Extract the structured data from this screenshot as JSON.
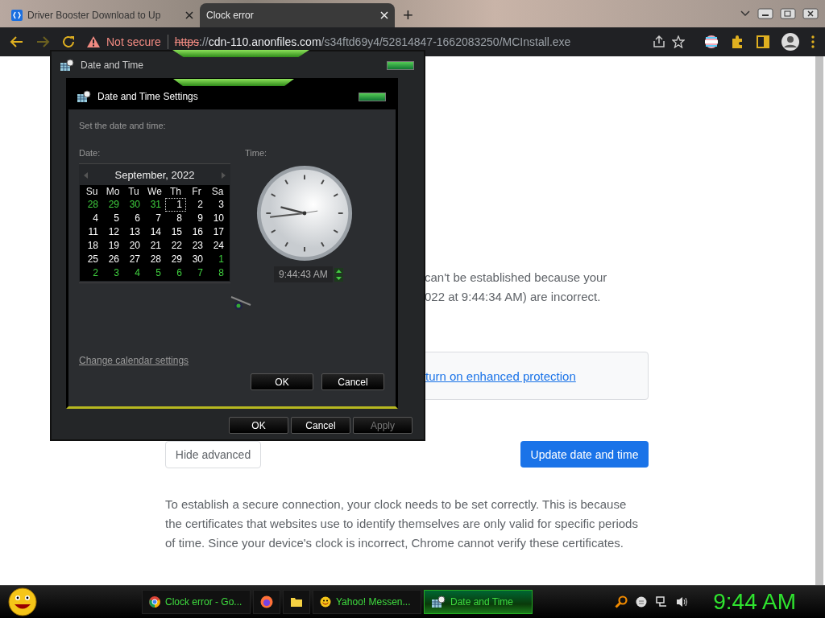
{
  "browser": {
    "tabs": [
      {
        "title": "Driver Booster Download to Up",
        "selected": false
      },
      {
        "title": "Clock error",
        "selected": true
      }
    ],
    "new_tab": "+",
    "toolbar": {
      "security": "Not secure",
      "url_scheme": "https",
      "url_sep": "://",
      "url_host": "cdn-110.anonfiles.com",
      "url_path": "/s34ftd69y4/52814847-1662083250/MCInstall.exe"
    }
  },
  "page": {
    "line_1": "can't be established because your",
    "line_2": "022 at 9:44:34 AM) are incorrect.",
    "protection_link": "turn on enhanced protection",
    "hide_button": "Hide advanced",
    "update_button": "Update date and time",
    "explanation": "To establish a secure connection, your clock needs to be set correctly. This is because the certificates that websites use to identify themselves are only valid for specific periods of time. Since your device's clock is incorrect, Chrome cannot verify these certificates."
  },
  "outer_dialog": {
    "title": "Date and Time",
    "buttons": [
      {
        "label": "OK",
        "disabled": false
      },
      {
        "label": "Cancel",
        "disabled": false
      },
      {
        "label": "Apply",
        "disabled": true
      }
    ]
  },
  "inner_dialog": {
    "title": "Date and Time Settings",
    "instruction": "Set the date and time:",
    "date_label": "Date:",
    "time_label": "Time:",
    "calendar": {
      "month": "September, 2022",
      "weekdays": [
        "Su",
        "Mo",
        "Tu",
        "We",
        "Th",
        "Fr",
        "Sa"
      ],
      "weeks": [
        [
          {
            "day": "28",
            "other_month": true,
            "selected": false
          },
          {
            "day": "29",
            "other_month": true,
            "selected": false
          },
          {
            "day": "30",
            "other_month": true,
            "selected": false
          },
          {
            "day": "31",
            "other_month": true,
            "selected": false
          },
          {
            "day": "1",
            "other_month": false,
            "selected": true
          },
          {
            "day": "2",
            "other_month": false,
            "selected": false
          },
          {
            "day": "3",
            "other_month": false,
            "selected": false
          }
        ],
        [
          {
            "day": "4",
            "other_month": false,
            "selected": false
          },
          {
            "day": "5",
            "other_month": false,
            "selected": false
          },
          {
            "day": "6",
            "other_month": false,
            "selected": false
          },
          {
            "day": "7",
            "other_month": false,
            "selected": false
          },
          {
            "day": "8",
            "other_month": false,
            "selected": false
          },
          {
            "day": "9",
            "other_month": false,
            "selected": false
          },
          {
            "day": "10",
            "other_month": false,
            "selected": false
          }
        ],
        [
          {
            "day": "11",
            "other_month": false,
            "selected": false
          },
          {
            "day": "12",
            "other_month": false,
            "selected": false
          },
          {
            "day": "13",
            "other_month": false,
            "selected": false
          },
          {
            "day": "14",
            "other_month": false,
            "selected": false
          },
          {
            "day": "15",
            "other_month": false,
            "selected": false
          },
          {
            "day": "16",
            "other_month": false,
            "selected": false
          },
          {
            "day": "17",
            "other_month": false,
            "selected": false
          }
        ],
        [
          {
            "day": "18",
            "other_month": false,
            "selected": false
          },
          {
            "day": "19",
            "other_month": false,
            "selected": false
          },
          {
            "day": "20",
            "other_month": false,
            "selected": false
          },
          {
            "day": "21",
            "other_month": false,
            "selected": false
          },
          {
            "day": "22",
            "other_month": false,
            "selected": false
          },
          {
            "day": "23",
            "other_month": false,
            "selected": false
          },
          {
            "day": "24",
            "other_month": false,
            "selected": false
          }
        ],
        [
          {
            "day": "25",
            "other_month": false,
            "selected": false
          },
          {
            "day": "26",
            "other_month": false,
            "selected": false
          },
          {
            "day": "27",
            "other_month": false,
            "selected": false
          },
          {
            "day": "28",
            "other_month": false,
            "selected": false
          },
          {
            "day": "29",
            "other_month": false,
            "selected": false
          },
          {
            "day": "30",
            "other_month": false,
            "selected": false
          },
          {
            "day": "1",
            "other_month": true,
            "selected": false
          }
        ],
        [
          {
            "day": "2",
            "other_month": true,
            "selected": false
          },
          {
            "day": "3",
            "other_month": true,
            "selected": false
          },
          {
            "day": "4",
            "other_month": true,
            "selected": false
          },
          {
            "day": "5",
            "other_month": true,
            "selected": false
          },
          {
            "day": "6",
            "other_month": true,
            "selected": false
          },
          {
            "day": "7",
            "other_month": true,
            "selected": false
          },
          {
            "day": "8",
            "other_month": true,
            "selected": false
          }
        ]
      ]
    },
    "time_value": "9:44:43 AM",
    "calendar_link": "Change calendar settings",
    "buttons": [
      {
        "label": "OK"
      },
      {
        "label": "Cancel"
      }
    ]
  },
  "taskbar": {
    "items": [
      {
        "kind": "chrome",
        "label": "Clock error - Go...",
        "selected": false
      },
      {
        "kind": "firefox",
        "selected": false
      },
      {
        "kind": "folder",
        "selected": false
      },
      {
        "kind": "messenger",
        "label": "Yahoo! Messen...",
        "selected": false
      },
      {
        "kind": "datetime",
        "label": "Date and Time",
        "selected": true
      }
    ],
    "clock": "9:44 AM"
  }
}
